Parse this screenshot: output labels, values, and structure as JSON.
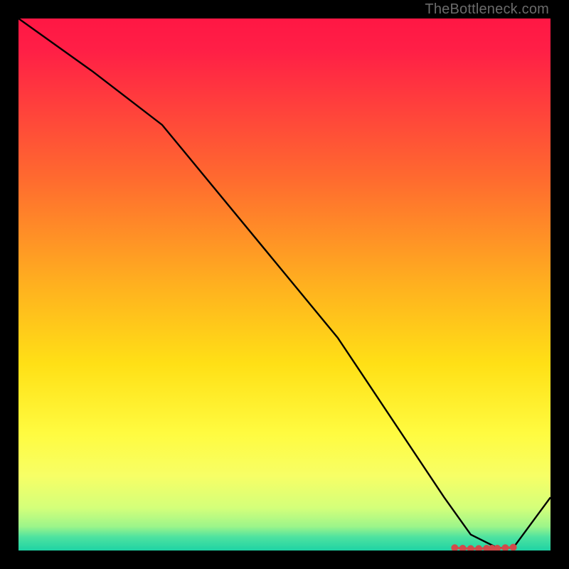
{
  "watermark": "TheBottleneck.com",
  "chart_data": {
    "type": "line",
    "title": "",
    "xlabel": "",
    "ylabel": "",
    "xlim": [
      0,
      100
    ],
    "ylim": [
      0,
      100
    ],
    "grid": false,
    "legend": false,
    "gradient_stops": [
      {
        "offset": 0.0,
        "color": "#ff1744"
      },
      {
        "offset": 0.06,
        "color": "#ff1f46"
      },
      {
        "offset": 0.3,
        "color": "#ff6a2f"
      },
      {
        "offset": 0.5,
        "color": "#ffb01f"
      },
      {
        "offset": 0.65,
        "color": "#ffe016"
      },
      {
        "offset": 0.78,
        "color": "#fffb40"
      },
      {
        "offset": 0.86,
        "color": "#f7ff66"
      },
      {
        "offset": 0.92,
        "color": "#d4ff7a"
      },
      {
        "offset": 0.955,
        "color": "#9cf58a"
      },
      {
        "offset": 0.975,
        "color": "#4de2a0"
      },
      {
        "offset": 1.0,
        "color": "#1fd3a4"
      }
    ],
    "series": [
      {
        "name": "bottleneck-curve",
        "x": [
          0,
          14,
          27,
          60,
          80,
          85,
          90,
          93,
          100
        ],
        "values": [
          100,
          90,
          80,
          40,
          10,
          3,
          0.5,
          0.5,
          10
        ],
        "color": "#000000",
        "width": 2.4
      }
    ],
    "markers": {
      "name": "optimal-range",
      "color": "#d24a4a",
      "radius": 5,
      "points": [
        {
          "x": 82,
          "y": 0.5
        },
        {
          "x": 83.5,
          "y": 0.4
        },
        {
          "x": 85,
          "y": 0.35
        },
        {
          "x": 86.5,
          "y": 0.35
        },
        {
          "x": 88,
          "y": 0.4
        },
        {
          "x": 89,
          "y": 0.4
        },
        {
          "x": 90,
          "y": 0.4
        },
        {
          "x": 91.5,
          "y": 0.5
        },
        {
          "x": 93,
          "y": 0.6
        }
      ]
    }
  }
}
